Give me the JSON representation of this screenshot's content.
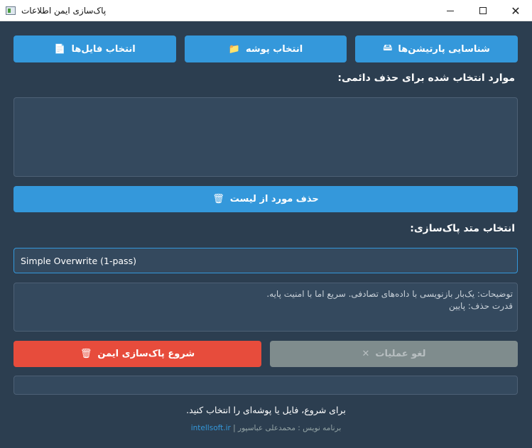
{
  "window": {
    "title": "پاک‌سازی ایمن اطلاعات",
    "minimize_icon": "minimize-icon",
    "maximize_icon": "maximize-icon",
    "close_icon": "close-icon"
  },
  "top_buttons": [
    {
      "label": "شناسایی پارتیشن‌ها",
      "icon": "🖴"
    },
    {
      "label": "انتخاب پوشه",
      "icon": "📁"
    },
    {
      "label": "انتخاب فایل‌ها",
      "icon": "📄"
    }
  ],
  "selected_section": {
    "heading": "موارد انتخاب شده برای حذف دائمی:"
  },
  "remove_button": {
    "label": "حذف مورد از لیست",
    "icon": "🗑"
  },
  "method_section": {
    "heading": "انتخاب متد پاک‌سازی:",
    "selected_method": "Simple Overwrite (1-pass)",
    "description_line1": "توضیحات: یک‌بار بازنویسی با داده‌های تصادفی. سریع اما با امنیت پایه.",
    "description_line2": "قدرت حذف: پایین"
  },
  "start_button": {
    "label": "شروع پاک‌سازی ایمن",
    "icon": "🗑"
  },
  "cancel_button": {
    "label": "لغو عملیات",
    "icon": "✕"
  },
  "status_text": "برای شروع، فایل یا پوشه‌ای را انتخاب کنید.",
  "footer": {
    "credit_text": "برنامه نویس : محمدعلی عباسپور |",
    "link_text": "intellsoft.ir"
  },
  "colors": {
    "background": "#2c3e50",
    "accent": "#3498db",
    "danger": "#e74c3c",
    "disabled": "#7f8c8d"
  }
}
